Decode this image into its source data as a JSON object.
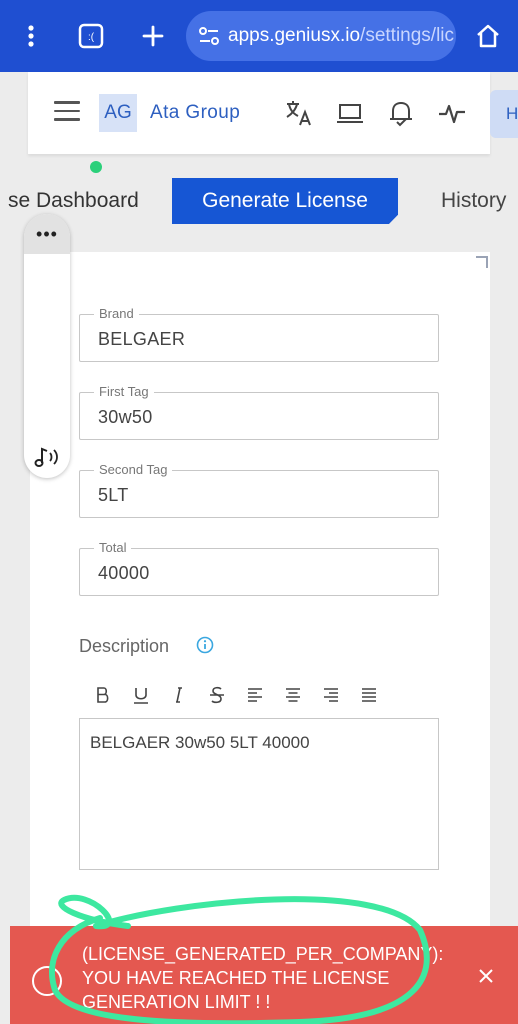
{
  "browser": {
    "url_host": "apps.geniusx.io",
    "url_path": "/settings/lic",
    "icons": [
      "more-vert-icon",
      "tab-switcher-icon",
      "new-tab-icon",
      "site-settings-icon",
      "home-icon"
    ]
  },
  "header": {
    "badge": "AG",
    "org_name": "Ata Group",
    "extra_button": "H",
    "icons": [
      "menu-icon",
      "translate-icon",
      "laptop-icon",
      "bell-check-icon",
      "pulse-icon"
    ]
  },
  "tabs": [
    {
      "label": "se Dashboard",
      "active": false
    },
    {
      "label": "Generate License",
      "active": true
    },
    {
      "label": "History",
      "active": false
    }
  ],
  "side_panel": {
    "top_label": "•••"
  },
  "form": {
    "fields": [
      {
        "label": "Brand",
        "value": "BELGAER"
      },
      {
        "label": "First Tag",
        "value": "30w50"
      },
      {
        "label": "Second Tag",
        "value": "5LT"
      },
      {
        "label": "Total",
        "value": "40000"
      }
    ],
    "description_label": "Description",
    "toolbar": [
      "bold",
      "underline",
      "italic",
      "strikethrough",
      "align-left",
      "align-center",
      "align-right",
      "align-justify"
    ],
    "description_value": "BELGAER 30w50 5LT 40000"
  },
  "toast": {
    "message": "(LICENSE_GENERATED_PER_COMPANY): YOU HAVE REACHED THE LICENSE GENERATION LIMIT ! !",
    "color": "#e45850"
  },
  "colors": {
    "browser_bar": "#1f4fd1",
    "accent": "#1656d4",
    "brand_text": "#2d5fc0",
    "highlight_stroke": "#3de8a0"
  }
}
